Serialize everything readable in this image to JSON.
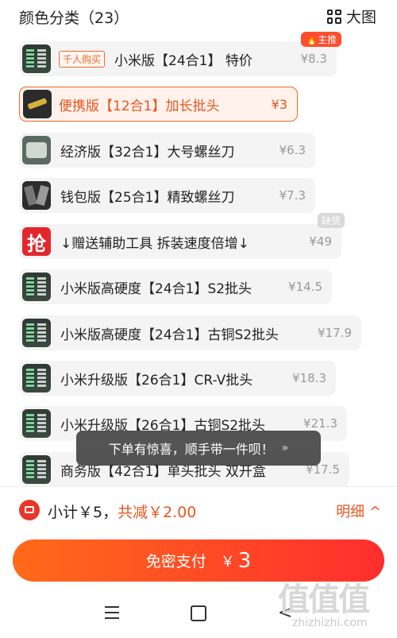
{
  "header": {
    "title": "颜色分类（23）",
    "view_label": "大图"
  },
  "items": [
    {
      "label": "小米版【24合1】 特价",
      "price": "¥8.3",
      "tag": "千人购买",
      "badge": "🔥主推"
    },
    {
      "label": "便携版【12合1】加长批头",
      "price": "¥3"
    },
    {
      "label": "经济版【32合1】大号螺丝刀",
      "price": "¥6.3"
    },
    {
      "label": "钱包版【25合1】精致螺丝刀",
      "price": "¥7.3"
    },
    {
      "label": "↓赠送辅助工具 拆装速度倍增↓",
      "price": "¥49",
      "badge": "缺货",
      "thumb_text": "抢"
    },
    {
      "label": "小米版高硬度【24合1】S2批头",
      "price": "¥14.5"
    },
    {
      "label": "小米版高硬度【24合1】古铜S2批头",
      "price": "¥17.9"
    },
    {
      "label": "小米升级版【26合1】CR-V批头",
      "price": "¥18.3"
    },
    {
      "label": "小米升级版【26合1】古铜S2批头",
      "price": "¥21.3"
    },
    {
      "label": "商务版【42合1】单头批头 双开盒",
      "price": "¥17.5"
    }
  ],
  "toast": {
    "text": "下单有惊喜，顺手带一件呗！",
    "chevron": "»"
  },
  "summary": {
    "subtotal": "小计￥5，",
    "discount": "共减￥2.00",
    "detail_label": "明细 ^"
  },
  "pay_button": {
    "label": "免密支付",
    "currency": "￥",
    "amount": "3"
  },
  "navbar": {
    "back_glyph": "<"
  },
  "watermark": {
    "logo": "值值值",
    "url": "zhizhizhi.com"
  }
}
